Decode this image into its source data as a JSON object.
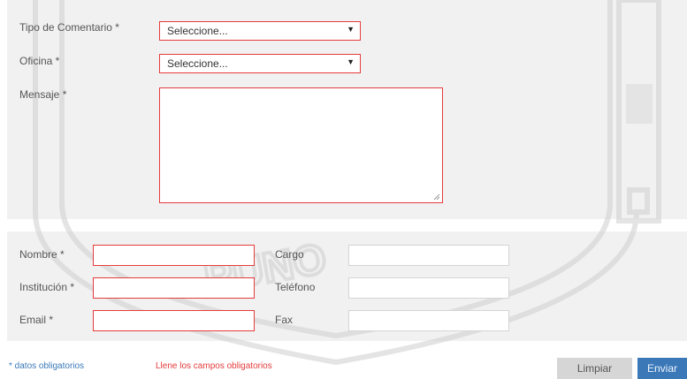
{
  "form": {
    "tipo_label": "Tipo de Comentario *",
    "tipo_value": "Seleccione...",
    "oficina_label": "Oficina *",
    "oficina_value": "Seleccione...",
    "mensaje_label": "Mensaje *",
    "mensaje_value": ""
  },
  "contact": {
    "nombre_label": "Nombre *",
    "institucion_label": "Institución *",
    "email_label": "Email *",
    "cargo_label": "Cargo",
    "telefono_label": "Teléfono",
    "fax_label": "Fax"
  },
  "footer": {
    "required_note": "* datos obligatorios",
    "error_message": "Llene los campos obligatorios",
    "clear_label": "Limpiar",
    "submit_label": "Enviar"
  },
  "colors": {
    "required_border": "#e53b3b",
    "note_blue": "#3a78b8",
    "error_red": "#e53b3b",
    "submit_bg": "#3a78b8",
    "clear_bg": "#d6d6d6",
    "panel_bg": "#f1f1f1"
  },
  "icons": {
    "dropdown": "caret-down",
    "resize": "resize-grip",
    "watermark": "university-crest"
  }
}
